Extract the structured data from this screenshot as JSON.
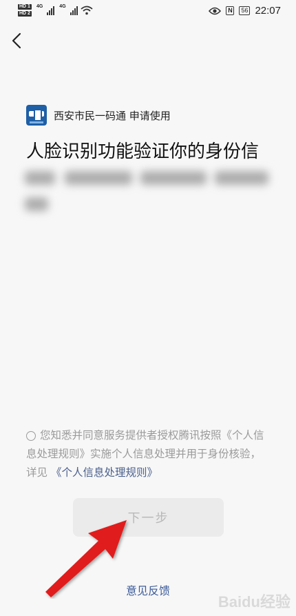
{
  "status_bar": {
    "hd1": "HD 1",
    "hd2": "HD 2",
    "net1": "4G",
    "net2": "4G",
    "nfc": "N",
    "battery": "56",
    "time": "22:07"
  },
  "app": {
    "title": "西安市民一码通 申请使用"
  },
  "headline": "人脸识别功能验证你的身份信",
  "consent": {
    "text": "您知悉并同意服务提供者授权腾讯按照《个人信息处理规则》实施个人信息处理并用于身份核验，详见 ",
    "link": "《个人信息处理规则》"
  },
  "next_button": "下一步",
  "feedback": "意见反馈",
  "watermark": "Baidu经验",
  "colors": {
    "link": "#4a5f8d",
    "feedback": "#3b5b9a",
    "arrow": "#e01b1b"
  }
}
